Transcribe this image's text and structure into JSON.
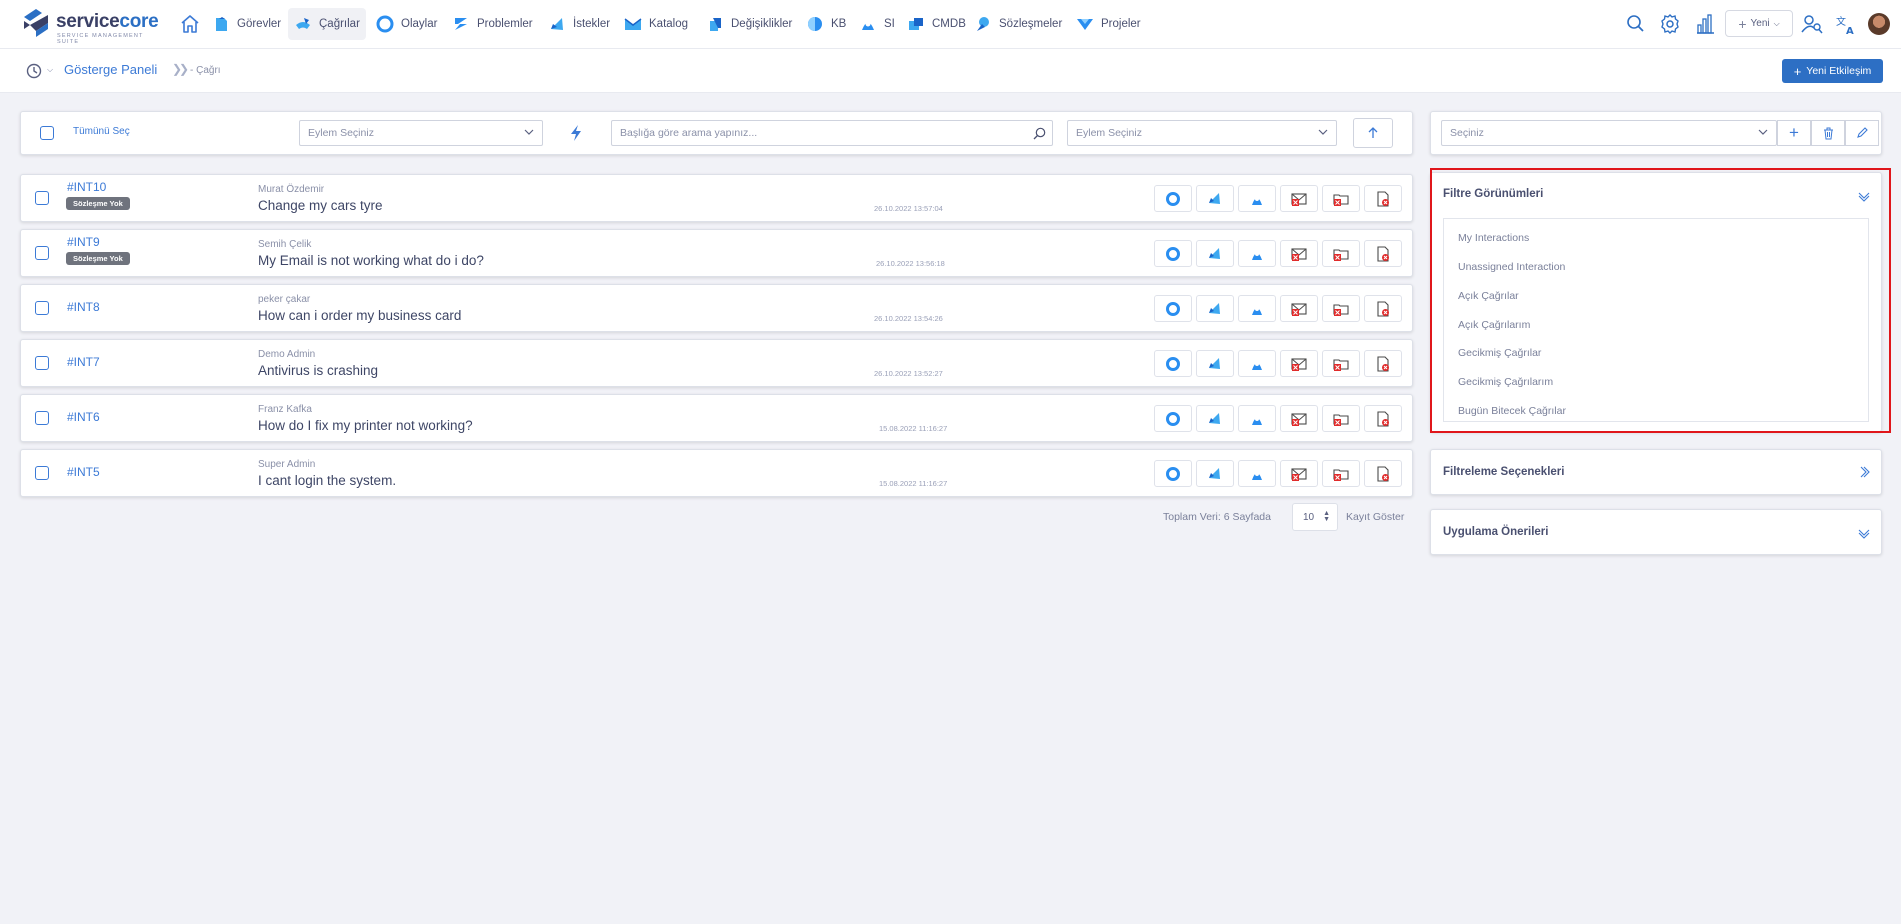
{
  "brand": {
    "name_a": "service",
    "name_b": "core",
    "tagline": "SERVICE MANAGEMENT SUITE"
  },
  "nav": {
    "items": [
      {
        "label": "Görevler",
        "icon": "tasks-icon"
      },
      {
        "label": "Çağrılar",
        "icon": "calls-icon",
        "active": true
      },
      {
        "label": "Olaylar",
        "icon": "incidents-icon"
      },
      {
        "label": "Problemler",
        "icon": "problems-icon"
      },
      {
        "label": "İstekler",
        "icon": "requests-icon"
      },
      {
        "label": "Katalog",
        "icon": "catalog-icon"
      },
      {
        "label": "Değişiklikler",
        "icon": "changes-icon"
      },
      {
        "label": "KB",
        "icon": "kb-icon"
      },
      {
        "label": "SI",
        "icon": "si-icon"
      },
      {
        "label": "CMDB",
        "icon": "cmdb-icon"
      },
      {
        "label": "Sözleşmeler",
        "icon": "contracts-icon"
      },
      {
        "label": "Projeler",
        "icon": "projects-icon"
      }
    ],
    "new_label": "Yeni"
  },
  "breadcrumb": {
    "title": "Gösterge Paneli",
    "current": "Çağrı",
    "new_button": "Yeni Etkileşim"
  },
  "toolbar": {
    "select_all": "Tümünü Seç",
    "action_placeholder": "Eylem Seçiniz",
    "search_placeholder": "Başlığa göre arama yapınız...",
    "action2_placeholder": "Eylem Seçiniz"
  },
  "rows": [
    {
      "id": "#INT10",
      "badge": "Sözleşme Yok",
      "user": "Murat Özdemir",
      "title": "Change my cars tyre",
      "date": "26.10.2022 13:57:04"
    },
    {
      "id": "#INT9",
      "badge": "Sözleşme Yok",
      "user": "Semih Çelik",
      "title": "My Email is not working what do i do?",
      "date": "26.10.2022 13:56:18"
    },
    {
      "id": "#INT8",
      "badge": "",
      "user": "peker çakar",
      "title": "How can i order my business card",
      "date": "26.10.2022 13:54:26"
    },
    {
      "id": "#INT7",
      "badge": "",
      "user": "Demo Admin",
      "title": "Antivirus is crashing",
      "date": "26.10.2022 13:52:27"
    },
    {
      "id": "#INT6",
      "badge": "",
      "user": "Franz Kafka",
      "title": "How do I fix my printer not working?",
      "date": "15.08.2022 11:16:27"
    },
    {
      "id": "#INT5",
      "badge": "",
      "user": "Super Admin",
      "title": "I cant login the system.",
      "date": "15.08.2022 11:16:27"
    }
  ],
  "pager": {
    "total": "Toplam Veri: 6 Sayfada",
    "page_size": "10",
    "suffix": "Kayıt Göster"
  },
  "right_panel": {
    "select_placeholder": "Seçiniz",
    "filter_views_title": "Filtre Görünümleri",
    "filter_views": [
      "My Interactions",
      "Unassigned Interaction",
      "Açık Çağrılar",
      "Açık Çağrılarım",
      "Gecikmiş Çağrılar",
      "Gecikmiş Çağrılarım",
      "Bugün Bitecek Çağrılar"
    ],
    "filter_options_title": "Filtreleme Seçenekleri",
    "app_suggestions_title": "Uygulama Önerileri"
  },
  "colors": {
    "accent": "#2d6fc4",
    "link": "#3c7ad6",
    "highlight": "#e0161b",
    "badge": "#6f737d"
  }
}
